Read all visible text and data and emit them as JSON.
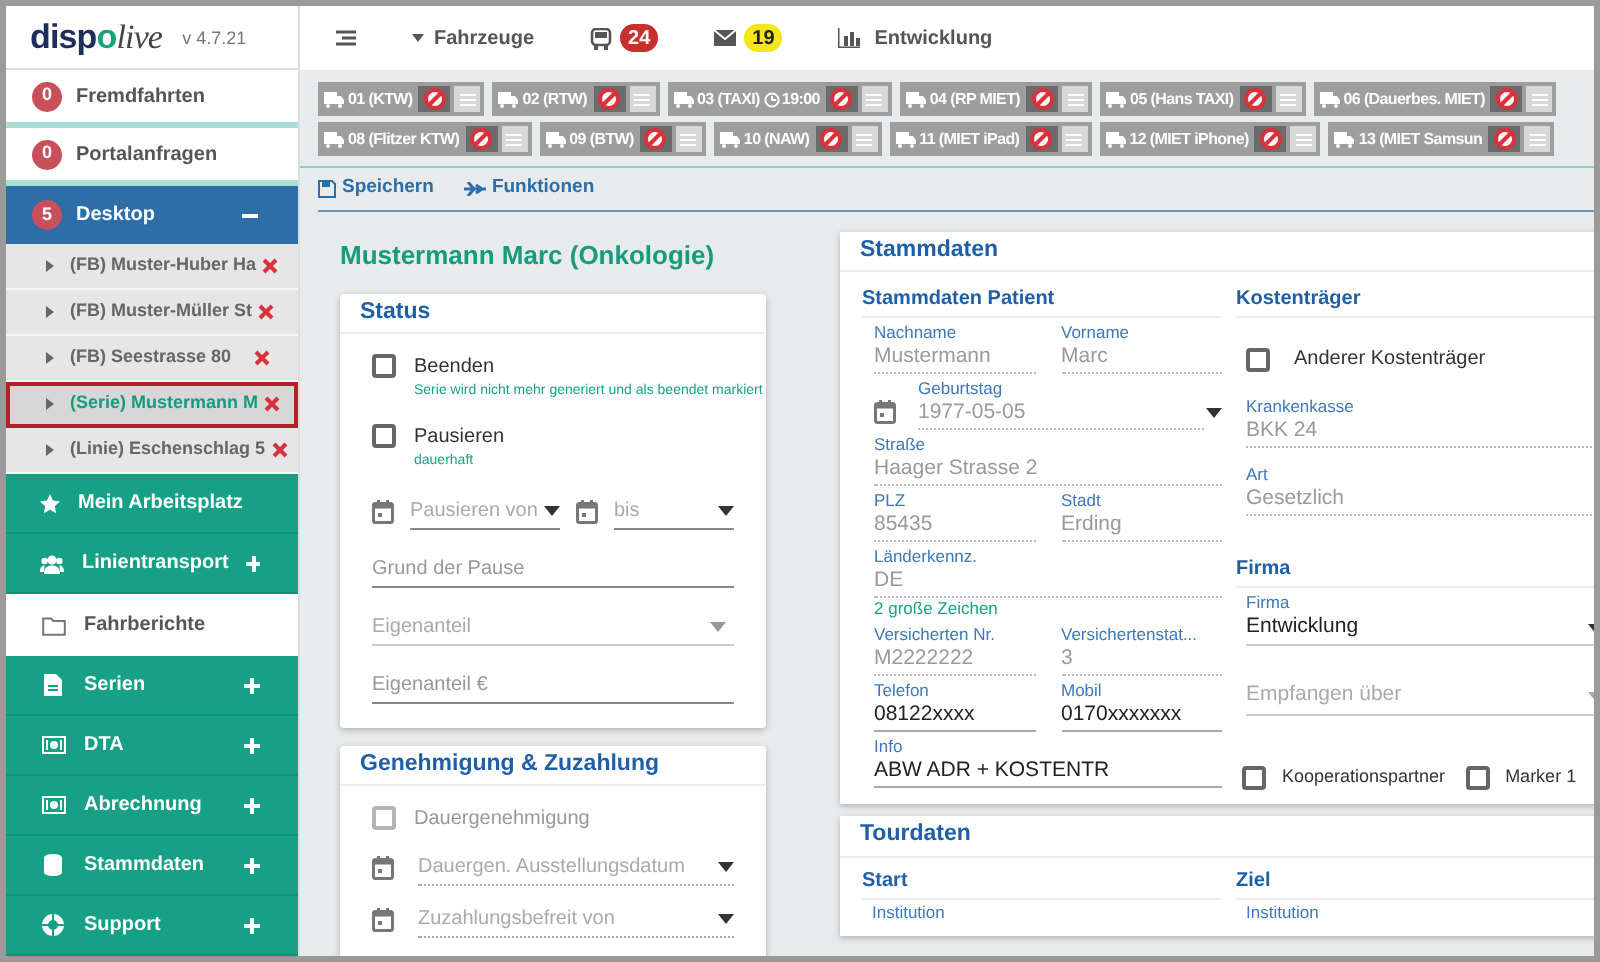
{
  "logo": {
    "part_1": "disp",
    "part_2": "o",
    "part_3": "live"
  },
  "version": "v 4.7.21",
  "topbar": [
    {
      "kind": "menu"
    },
    {
      "kind": "dropdown",
      "label": "Fahrzeuge"
    },
    {
      "kind": "vehicles",
      "badge": "24",
      "color": "#c9302c"
    },
    {
      "kind": "messages",
      "badge": "19",
      "color": "#f5e61a"
    },
    {
      "kind": "stats",
      "label": "Entwicklung"
    }
  ],
  "sidebar": [
    {
      "kind": "counter",
      "badge": "0",
      "label": "Fremdfahrten"
    },
    {
      "kind": "counter",
      "badge": "0",
      "label": "Portalanfragen"
    },
    {
      "kind": "section",
      "badge": "5",
      "label": "Desktop",
      "expanded": true,
      "children": [
        {
          "label": "(FB) Muster-Huber Ha",
          "selected": false
        },
        {
          "label": "(FB) Muster-Müller St",
          "selected": false
        },
        {
          "label": "(FB) Seestrasse 80",
          "selected": false
        },
        {
          "label": "(Serie) Mustermann M",
          "selected": true
        },
        {
          "label": "(Linie) Eschenschlag 5",
          "selected": false
        }
      ]
    },
    {
      "kind": "group",
      "label": "Mein Arbeitsplatz",
      "expanded": false
    },
    {
      "kind": "group",
      "label": "Linientransport",
      "expanded": false
    },
    {
      "kind": "link",
      "label": "Fahrberichte"
    },
    {
      "kind": "group",
      "label": "Serien",
      "expanded": false
    },
    {
      "kind": "group",
      "label": "DTA",
      "expanded": false
    },
    {
      "kind": "group",
      "label": "Abrechnung",
      "expanded": false
    },
    {
      "kind": "group",
      "label": "Stammdaten",
      "expanded": false
    },
    {
      "kind": "group",
      "label": "Support",
      "expanded": false
    }
  ],
  "vehicle_rows": [
    [
      {
        "label": "01 (KTW)"
      },
      {
        "label": "02 (RTW)"
      },
      {
        "label": "03 (TAXI)",
        "time": "19:00"
      },
      {
        "label": "04 (RP MIET)"
      },
      {
        "label": "05 (Hans TAXI)"
      },
      {
        "label": "06 (Dauerbes. MIET)"
      }
    ],
    [
      {
        "label": "08 (Flitzer KTW)"
      },
      {
        "label": "09 (BTW)"
      },
      {
        "label": "10 (NAW)"
      },
      {
        "label": "11 (MIET iPad)"
      },
      {
        "label": "12 (MIET iPhone)"
      },
      {
        "label": "13 (MIET Samsun"
      }
    ]
  ],
  "toolbar": [
    {
      "label": "Speichern"
    },
    {
      "label": "Funktionen"
    }
  ],
  "patient_title": "Mustermann Marc (Onkologie)",
  "status_card": {
    "title": "Status",
    "items": [
      {
        "kind": "checkbox",
        "label": "Beenden",
        "hint": "Serie wird nicht mehr generiert und als beendet markiert",
        "checked": false,
        "disabled": false
      },
      {
        "kind": "checkbox",
        "label": "Pausieren",
        "hint": "dauerhaft",
        "checked": false,
        "disabled": false
      },
      {
        "kind": "daterange",
        "from": "Pausieren von",
        "to": "bis"
      },
      {
        "kind": "input",
        "placeholder": "Grund der Pause"
      },
      {
        "kind": "select",
        "placeholder": "Eigenanteil"
      },
      {
        "kind": "input",
        "placeholder": "Eigenanteil €"
      }
    ]
  },
  "approval_card": {
    "title": "Genehmigung & Zuzahlung",
    "items": [
      {
        "kind": "checkbox",
        "label": "Dauergenehmigung",
        "checked": false,
        "disabled": true
      },
      {
        "kind": "date",
        "placeholder": "Dauergen. Ausstellungsdatum",
        "disabled": true
      },
      {
        "kind": "date",
        "placeholder": "Zuzahlungsbefreit von",
        "disabled": true
      }
    ]
  },
  "master_card": {
    "title": "Stammdaten",
    "patient": {
      "title": "Stammdaten Patient",
      "rows": [
        [
          {
            "label": "Nachname",
            "value": "Mustermann",
            "disabled": true
          },
          {
            "label": "Vorname",
            "value": "Marc",
            "disabled": true
          }
        ],
        [
          {
            "kind": "date",
            "label": "Geburtstag",
            "value": "1977-05-05",
            "disabled": true
          }
        ],
        [
          {
            "label": "Straße",
            "value": "Haager Strasse 2",
            "disabled": true
          }
        ],
        [
          {
            "label": "PLZ",
            "value": "85435",
            "disabled": true
          },
          {
            "label": "Stadt",
            "value": "Erding",
            "disabled": true
          }
        ],
        [
          {
            "label": "Länderkennz.",
            "value": "DE",
            "hint": "2 große Zeichen",
            "disabled": true
          }
        ],
        [
          {
            "label": "Versicherten Nr.",
            "value": "M2222222",
            "disabled": true
          },
          {
            "label": "Versichertenstat...",
            "value": "3",
            "disabled": true
          }
        ],
        [
          {
            "label": "Telefon",
            "value": "08122xxxx",
            "disabled": false
          },
          {
            "label": "Mobil",
            "value": "0170xxxxxxx",
            "disabled": false
          }
        ],
        [
          {
            "label": "Info",
            "value": "ABW ADR + KOSTENTR",
            "disabled": false
          }
        ]
      ]
    },
    "payer": {
      "title": "Kostenträger",
      "checkbox": {
        "label": "Anderer Kostenträger",
        "checked": false
      },
      "fields": [
        {
          "label": "Krankenkasse",
          "value": "BKK 24",
          "disabled": true
        },
        {
          "label": "Art",
          "value": "Gesetzlich",
          "disabled": true
        }
      ]
    },
    "company": {
      "title": "Firma",
      "fields": [
        {
          "label": "Firma",
          "value": "Entwicklung"
        },
        {
          "placeholder": "Empfangen über"
        }
      ]
    },
    "flags": [
      {
        "label": "Kooperationspartner",
        "checked": false
      },
      {
        "label": "Marker 1",
        "checked": false
      }
    ]
  },
  "tour_card": {
    "title": "Tourdaten",
    "columns": [
      {
        "title": "Start",
        "field_label": "Institution"
      },
      {
        "title": "Ziel",
        "field_label": "Institution"
      }
    ]
  }
}
